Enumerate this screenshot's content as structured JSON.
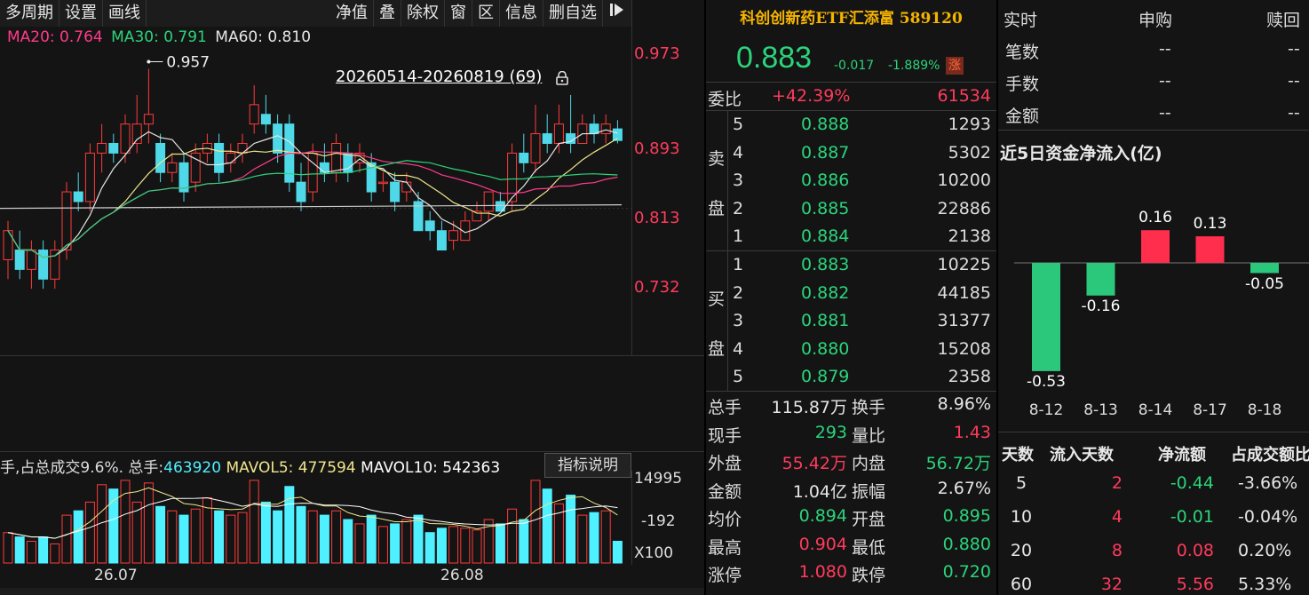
{
  "toolbar": {
    "left": [
      "多周期",
      "设置",
      "画线"
    ],
    "right": [
      "净值",
      "叠",
      "除权",
      "窗",
      "区",
      "信息",
      "删自选"
    ]
  },
  "ma": {
    "ma20": "MA20: 0.764",
    "ma30": "MA30: 0.791",
    "ma60": "MA60: 0.810",
    "colors": {
      "ma20": "#ff3b8a",
      "ma30": "#2bd47b",
      "ma60": "#e6e6e6"
    }
  },
  "range_label": "20260514-20260819 (69)",
  "peak_label": "0.957",
  "price_axis": [
    "0.973",
    "0.893",
    "0.813",
    "0.732"
  ],
  "vol": {
    "prefix": "手,占总成交9.6%.",
    "total_label": "总手:",
    "total": "463920",
    "mavol5": "MAVOL5: 477594",
    "mavol10": "MAVOL10: 542363",
    "button": "指标说明",
    "axis": [
      "14995",
      "-192",
      "X100"
    ]
  },
  "x_axis": [
    "26.07",
    "26.08"
  ],
  "quote": {
    "name": "科创创新药ETF汇添富 589120",
    "price": "0.883",
    "change": "-0.017",
    "change_pct": "-1.889%",
    "tag": "涨",
    "weibi_label": "委比",
    "weibi": "+42.39%",
    "weibi_val": "61534",
    "sell_label": "卖盘",
    "buy_label": "买盘",
    "sell": [
      {
        "lv": "5",
        "p": "0.888",
        "v": "1293"
      },
      {
        "lv": "4",
        "p": "0.887",
        "v": "5302"
      },
      {
        "lv": "3",
        "p": "0.886",
        "v": "10200"
      },
      {
        "lv": "2",
        "p": "0.885",
        "v": "22886"
      },
      {
        "lv": "1",
        "p": "0.884",
        "v": "2138"
      }
    ],
    "buy": [
      {
        "lv": "1",
        "p": "0.883",
        "v": "10225"
      },
      {
        "lv": "2",
        "p": "0.882",
        "v": "44185"
      },
      {
        "lv": "3",
        "p": "0.881",
        "v": "31377"
      },
      {
        "lv": "4",
        "p": "0.880",
        "v": "15208"
      },
      {
        "lv": "5",
        "p": "0.879",
        "v": "2358"
      }
    ],
    "stats": [
      {
        "l1": "总手",
        "v1": "115.87万",
        "c1": "white",
        "l2": "换手",
        "v2": "8.96%",
        "c2": "white"
      },
      {
        "l1": "现手",
        "v1": "293",
        "c1": "green",
        "l2": "量比",
        "v2": "1.43",
        "c2": "red"
      },
      {
        "l1": "外盘",
        "v1": "55.42万",
        "c1": "red",
        "l2": "内盘",
        "v2": "56.72万",
        "c2": "green"
      },
      {
        "l1": "金额",
        "v1": "1.04亿",
        "c1": "white",
        "l2": "振幅",
        "v2": "2.67%",
        "c2": "white"
      },
      {
        "l1": "均价",
        "v1": "0.894",
        "c1": "green",
        "l2": "开盘",
        "v2": "0.895",
        "c2": "green"
      },
      {
        "l1": "最高",
        "v1": "0.904",
        "c1": "red",
        "l2": "最低",
        "v2": "0.880",
        "c2": "green"
      },
      {
        "l1": "涨停",
        "v1": "1.080",
        "c1": "red",
        "l2": "跌停",
        "v2": "0.720",
        "c2": "green"
      }
    ]
  },
  "flow": {
    "head": [
      "实时",
      "申购",
      "赎回"
    ],
    "rows": [
      {
        "l": "笔数",
        "a": "--",
        "b": "--"
      },
      {
        "l": "手数",
        "a": "--",
        "b": "--"
      },
      {
        "l": "金额",
        "a": "--",
        "b": "--"
      }
    ],
    "title": "近5日资金净流入(亿)",
    "chart_data": {
      "type": "bar",
      "categories": [
        "8-12",
        "8-13",
        "8-14",
        "8-17",
        "8-18"
      ],
      "values": [
        -0.53,
        -0.16,
        0.16,
        0.13,
        -0.05
      ],
      "value_labels": [
        "-0.53",
        "-0.16",
        "0.16",
        "0.13",
        "-0.05"
      ]
    },
    "table_head": [
      "天数",
      "流入天数",
      "净流额",
      "占成交额比"
    ],
    "table": [
      {
        "d": "5",
        "n": "2",
        "f": "-0.44",
        "p": "-3.66%"
      },
      {
        "d": "10",
        "n": "4",
        "f": "-0.01",
        "p": "-0.04%"
      },
      {
        "d": "20",
        "n": "8",
        "f": "0.08",
        "p": "0.20%"
      },
      {
        "d": "60",
        "n": "32",
        "f": "5.56",
        "p": "5.33%"
      }
    ]
  }
}
